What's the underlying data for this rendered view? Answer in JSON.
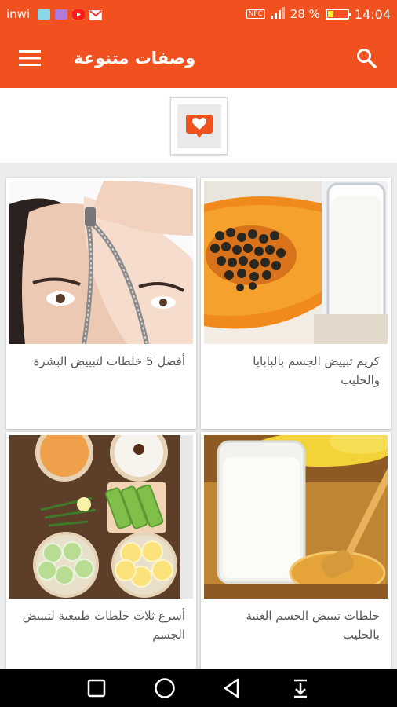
{
  "status_bar": {
    "carrier": "inwi",
    "battery_text": "28 %",
    "battery_level": 0.28,
    "time": "14:04",
    "nfc_label": "NFC"
  },
  "app_bar": {
    "title": "وصفات متنوعة",
    "menu_icon": "hamburger-menu-icon",
    "search_icon": "search-icon"
  },
  "banner": {
    "icon": "heart-speech-bubble-icon"
  },
  "cards": [
    {
      "title": "كريم تبييض الجسم بالبابايا والحليب",
      "image": "papaya-and-milk-glass-photo"
    },
    {
      "title": "أفضل 5 خلطات لتبييض البشرة",
      "image": "face-zipper-photo"
    },
    {
      "title": "خلطات تبييض الجسم الغنية بالحليب",
      "image": "milk-glass-with-honey-dipper-photo"
    },
    {
      "title": "أسرع ثلاث خلطات طبيعية لتبييض الجسم",
      "image": "cucumber-lemon-aloe-ingredients-photo"
    }
  ],
  "nav_bar": {
    "recents_icon": "square-recents-icon",
    "home_icon": "circle-home-icon",
    "back_icon": "triangle-back-icon",
    "notifications_icon": "pull-down-notifications-icon"
  },
  "colors": {
    "primary": "#f1511f",
    "title_text": "#555555",
    "background": "#ececec"
  }
}
